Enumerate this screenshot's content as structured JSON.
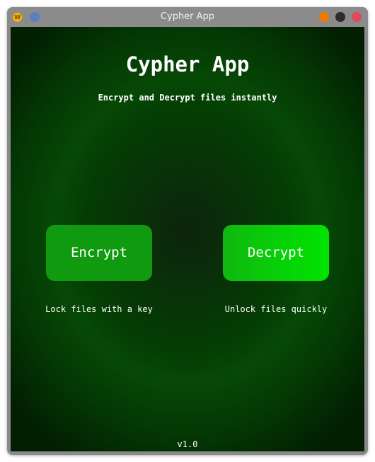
{
  "window": {
    "title": "Cypher App",
    "app_icon": "w-logo-icon",
    "controls": {
      "minimize_color": "#f07a00",
      "maximize_color": "#2c2c2c",
      "close_color": "#e04a5a"
    }
  },
  "main": {
    "title": "Cypher App",
    "subtitle": "Encrypt and Decrypt files instantly",
    "encrypt": {
      "label": "Encrypt",
      "description": "Lock files with a key",
      "color": "#0f9a0f"
    },
    "decrypt": {
      "label": "Decrypt",
      "description": "Unlock files quickly",
      "color": "#00e400"
    },
    "version": "v1.0"
  },
  "theme": {
    "background": "#043d04",
    "text": "#ffffff"
  }
}
